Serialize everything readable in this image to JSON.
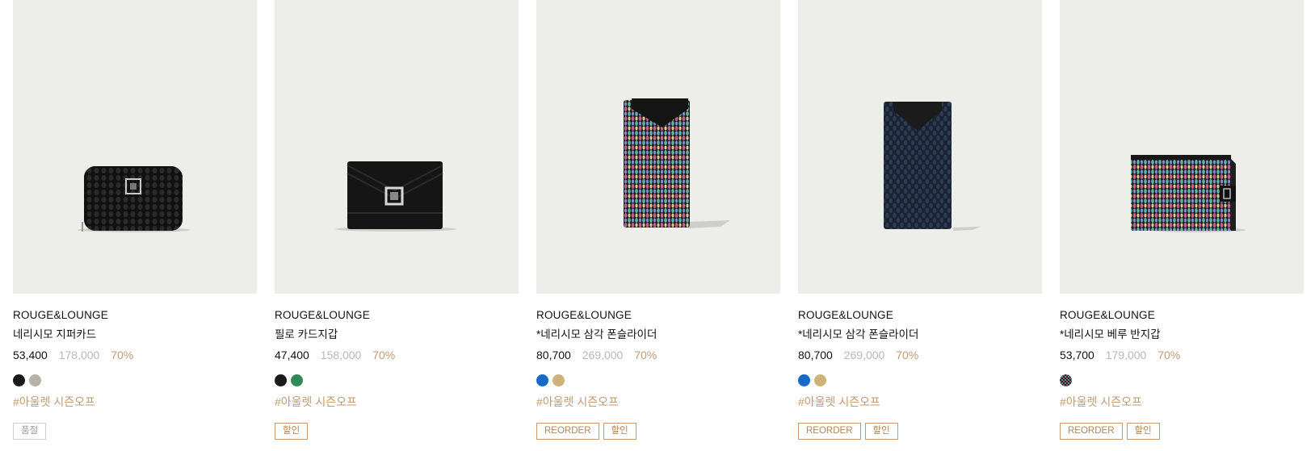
{
  "products": [
    {
      "brand": "ROUGE&LOUNGE",
      "name": "네리시모 지퍼카드",
      "price": "53,400",
      "original_price": "178,000",
      "discount": "70%",
      "colors": [
        "#1a1a1a",
        "#b7b2a6"
      ],
      "tag": "#아울렛 시즌오프",
      "badges": [
        {
          "label": "품절",
          "style": "gray"
        }
      ]
    },
    {
      "brand": "ROUGE&LOUNGE",
      "name": "필로 카드지갑",
      "price": "47,400",
      "original_price": "158,000",
      "discount": "70%",
      "colors": [
        "#1a1a1a",
        "#2f8a5a"
      ],
      "tag": "#아울렛 시즌오프",
      "badges": [
        {
          "label": "할인",
          "style": "accent"
        }
      ]
    },
    {
      "brand": "ROUGE&LOUNGE",
      "name": "*네리시모 삼각 폰슬라이더",
      "price": "80,700",
      "original_price": "269,000",
      "discount": "70%",
      "colors": [
        "#1769c7",
        "#cdb37a"
      ],
      "tag": "#아울렛 시즌오프",
      "badges": [
        {
          "label": "REORDER",
          "style": "accent"
        },
        {
          "label": "할인",
          "style": "accent"
        }
      ]
    },
    {
      "brand": "ROUGE&LOUNGE",
      "name": "*네리시모 삼각 폰슬라이더",
      "price": "80,700",
      "original_price": "269,000",
      "discount": "70%",
      "colors": [
        "#1769c7",
        "#cdb37a"
      ],
      "tag": "#아울렛 시즌오프",
      "badges": [
        {
          "label": "REORDER",
          "style": "accent"
        },
        {
          "label": "할인",
          "style": "accent"
        }
      ]
    },
    {
      "brand": "ROUGE&LOUNGE",
      "name": "*네리시모 베루 반지갑",
      "price": "53,700",
      "original_price": "179,000",
      "discount": "70%",
      "colors": [
        "pattern-multi"
      ],
      "tag": "#아울렛 시즌오프",
      "badges": [
        {
          "label": "REORDER",
          "style": "accent"
        },
        {
          "label": "할인",
          "style": "accent"
        }
      ]
    }
  ],
  "icons": [
    "zip-wallet-image",
    "card-wallet-image",
    "phone-slider-multi-image",
    "phone-slider-navy-image",
    "bifold-wallet-image"
  ]
}
